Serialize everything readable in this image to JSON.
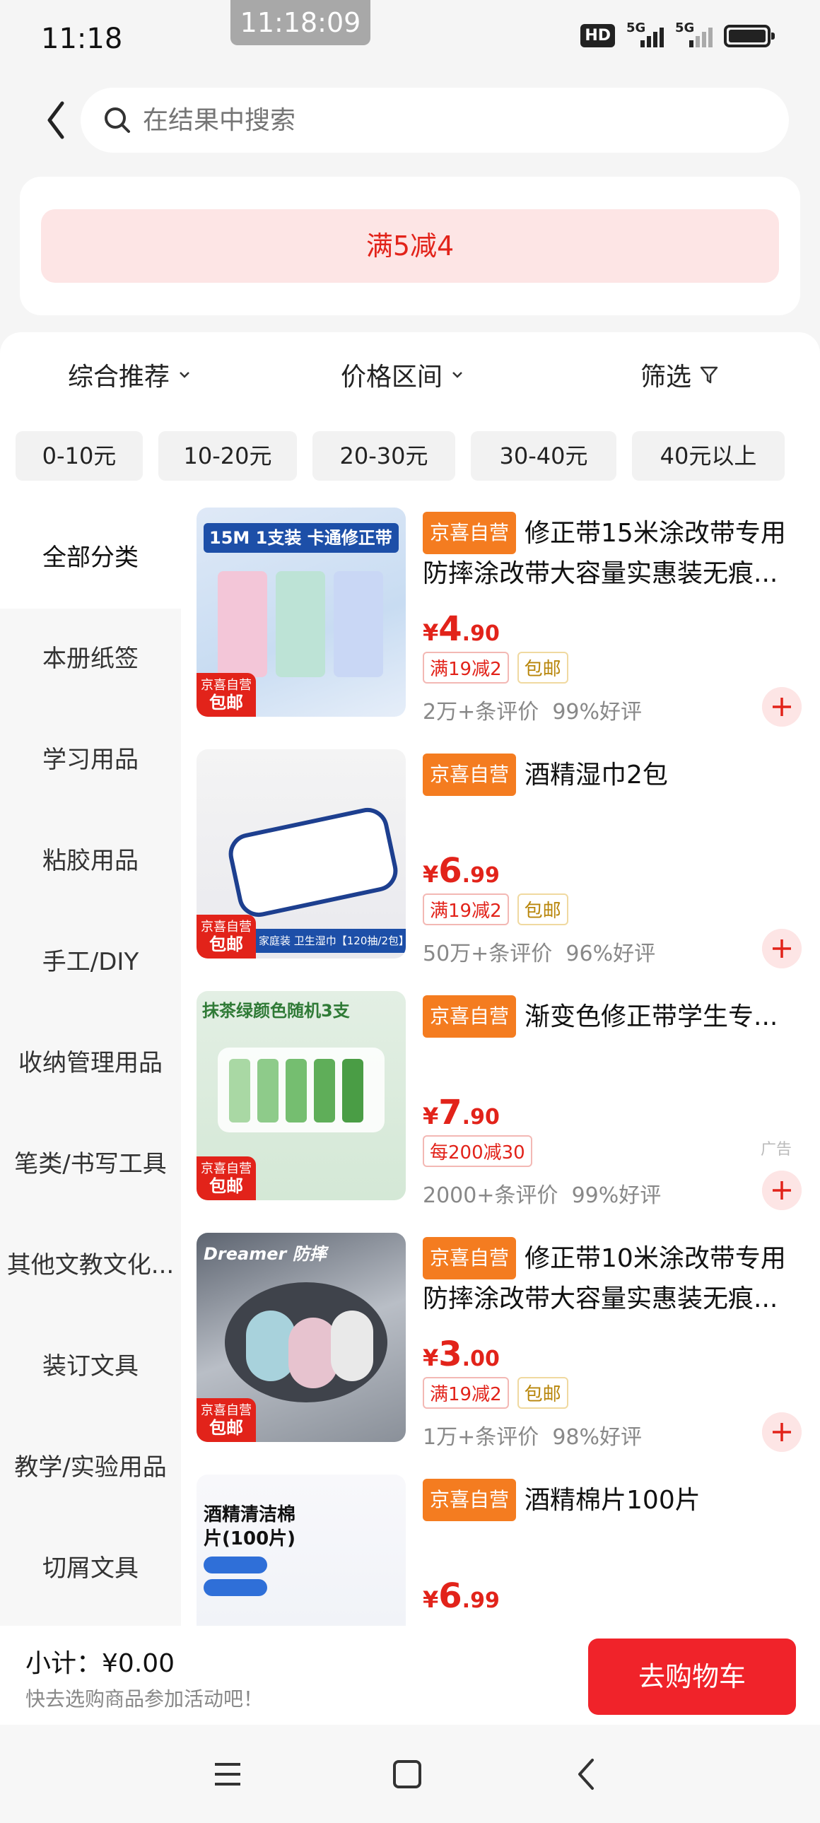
{
  "status_bar": {
    "time": "11:18",
    "recording_time": "11:18:09",
    "network_1": "5G",
    "network_2": "5G",
    "hd_label": "HD"
  },
  "search": {
    "placeholder": "在结果中搜索"
  },
  "promo": {
    "banner": "满5减4"
  },
  "sort": {
    "items": [
      {
        "label": "综合推荐"
      },
      {
        "label": "价格区间"
      },
      {
        "label": "筛选"
      }
    ]
  },
  "price_ranges": [
    "0-10元",
    "10-20元",
    "20-30元",
    "30-40元",
    "40元以上"
  ],
  "categories": [
    "全部分类",
    "本册纸签",
    "学习用品",
    "粘胶用品",
    "手工/DIY",
    "收纳管理用品",
    "笔类/书写工具",
    "其他文教文化...",
    "装订文具",
    "教学/实验用品",
    "切屑文具"
  ],
  "products": [
    {
      "badge": "京喜自营",
      "title": "修正带15米涂改带专用防摔涂改带大容量实惠装无痕...",
      "price_sym": "¥",
      "price_int": "4",
      "price_dec": ".90",
      "tags": [
        "满19减2",
        "包邮"
      ],
      "reviews": "2万+条评价",
      "rating": "99%好评",
      "ad": "",
      "thumb_badge_top": "京喜自营",
      "thumb_badge_bottom": "包邮",
      "thumb_text": "15M 1支装 卡通修正带"
    },
    {
      "badge": "京喜自营",
      "title": "酒精湿巾2包",
      "price_sym": "¥",
      "price_int": "6",
      "price_dec": ".99",
      "tags": [
        "满19减2",
        "包邮"
      ],
      "reviews": "50万+条评价",
      "rating": "96%好评",
      "ad": "",
      "thumb_badge_top": "京喜自营",
      "thumb_badge_bottom": "包邮",
      "thumb_text": "家庭装 卫生湿巾【120抽/2包】"
    },
    {
      "badge": "京喜自营",
      "title": "渐变色修正带学生专...",
      "price_sym": "¥",
      "price_int": "7",
      "price_dec": ".90",
      "tags": [
        "每200减30"
      ],
      "reviews": "2000+条评价",
      "rating": "99%好评",
      "ad": "广告",
      "thumb_badge_top": "京喜自营",
      "thumb_badge_bottom": "包邮",
      "thumb_text": "抹茶绿颜色随机3支"
    },
    {
      "badge": "京喜自营",
      "title": "修正带10米涂改带专用防摔涂改带大容量实惠装无痕...",
      "price_sym": "¥",
      "price_int": "3",
      "price_dec": ".00",
      "tags": [
        "满19减2",
        "包邮"
      ],
      "reviews": "1万+条评价",
      "rating": "98%好评",
      "ad": "",
      "thumb_badge_top": "京喜自营",
      "thumb_badge_bottom": "包邮",
      "thumb_text": "Dreamer 防摔"
    },
    {
      "badge": "京喜自营",
      "title": "酒精棉片100片",
      "price_sym": "¥",
      "price_int": "6",
      "price_dec": ".99",
      "tags": [],
      "reviews": "",
      "rating": "",
      "ad": "",
      "thumb_badge_top": "",
      "thumb_badge_bottom": "",
      "thumb_text": "酒精清洁棉片(100片)"
    }
  ],
  "cart": {
    "subtotal_label": "小计：",
    "subtotal_value": "¥0.00",
    "hint": "快去选购商品参加活动吧！",
    "button": "去购物车"
  },
  "colors": {
    "accent": "#e2231a",
    "badge_orange": "#f47c20",
    "button_red": "#f0232a"
  }
}
